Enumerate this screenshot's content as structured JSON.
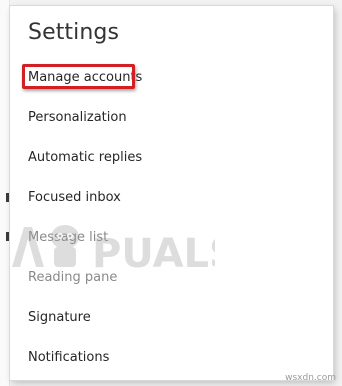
{
  "settings": {
    "title": "Settings",
    "items": [
      {
        "label": "Manage accounts",
        "highlighted": true
      },
      {
        "label": "Personalization"
      },
      {
        "label": "Automatic replies"
      },
      {
        "label": "Focused inbox"
      },
      {
        "label": "Message list"
      },
      {
        "label": "Reading pane"
      },
      {
        "label": "Signature"
      },
      {
        "label": "Notifications"
      }
    ]
  },
  "watermark": {
    "text": "APPUALS",
    "site": "wsxdn.com"
  },
  "colors": {
    "highlight_border": "#d11f24",
    "panel_background": "#ffffff",
    "text": "#262626"
  }
}
